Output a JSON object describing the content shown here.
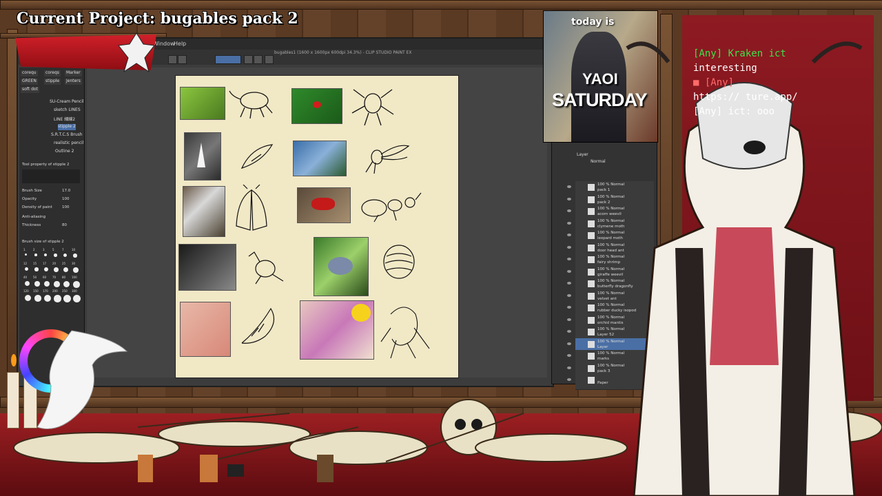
{
  "overlay": {
    "title": "Current Project: bugables pack 2"
  },
  "app": {
    "window_title": "bugables1 (1600 x 1600px 600dpi 34.3%) - CLIP STUDIO PAINT EX",
    "menu": [
      "Window",
      "Help"
    ],
    "tool_tabs": [
      "corequ",
      "coreqs",
      "Marker",
      "GREEN",
      "stipple",
      "Jenters",
      "soft dot"
    ],
    "brushes": [
      "SU-Cream Pencil",
      "sketch LINES",
      "LINE 細線2",
      "stipple 2",
      "S.R.T.C.S Brush",
      "realistic pencil",
      "Outline 2"
    ],
    "tool_property_title": "Tool property of stipple 2",
    "brush_size_label": "Brush Size",
    "brush_size_value": "17.0",
    "opacity_label": "Opacity",
    "opacity_value": "100",
    "density_label": "Density of paint",
    "density_value": "100",
    "antialias_label": "Anti-aliasing",
    "thickness_label": "Thickness",
    "thickness_value": "80",
    "brush_size_panel": "Brush size of stipple 2",
    "size_presets": [
      "1",
      "2",
      "3",
      "5",
      "7",
      "10",
      "12",
      "15",
      "17",
      "20",
      "25",
      "30",
      "40",
      "50",
      "60",
      "70",
      "80",
      "100",
      "120",
      "150",
      "170",
      "200",
      "250",
      "300"
    ],
    "layer_panel": {
      "tab": "Layer",
      "blend": "Normal",
      "layers": [
        {
          "pct": "100 % Normal",
          "name": "pack 1"
        },
        {
          "pct": "100 % Normal",
          "name": "pack 2"
        },
        {
          "pct": "100 % Normal",
          "name": "acorn weevil"
        },
        {
          "pct": "100 % Normal",
          "name": "clymene moth"
        },
        {
          "pct": "100 % Normal",
          "name": "leopard moth"
        },
        {
          "pct": "100 % Normal",
          "name": "door head ant"
        },
        {
          "pct": "100 % Normal",
          "name": "fairy shrimp"
        },
        {
          "pct": "100 % Normal",
          "name": "giraffe weevil"
        },
        {
          "pct": "100 % Normal",
          "name": "butterfly dragonfly"
        },
        {
          "pct": "100 % Normal",
          "name": "velvet ant"
        },
        {
          "pct": "100 % Normal",
          "name": "rubber ducky isopod"
        },
        {
          "pct": "100 % Normal",
          "name": "orchid mantis"
        },
        {
          "pct": "100 % Normal",
          "name": "Layer 52"
        },
        {
          "pct": "100 % Normal",
          "name": "Layer"
        },
        {
          "pct": "100 % Normal",
          "name": "marks"
        },
        {
          "pct": "100 % Normal",
          "name": "pack 3"
        },
        {
          "pct": "",
          "name": "Paper"
        }
      ]
    }
  },
  "meme": {
    "top": "today is",
    "middle": "YAOI",
    "bottom": "SATURDAY"
  },
  "chat": {
    "lines": [
      {
        "text": "[Any] Kraken  ict",
        "color": "#3fe04a"
      },
      {
        "text": "interesting",
        "color": "#ffffff"
      },
      {
        "text": "■ [Any]   ",
        "color": "#ff6a6a"
      },
      {
        "text": "https://   ture.app/",
        "color": "#ffffff"
      },
      {
        "text": "[Any]      ict: ooo",
        "color": "#ffffff"
      }
    ]
  },
  "colors": {
    "accent_red": "#c41a22",
    "canvas_bg": "#f1e8c6",
    "chat_green": "#3fe04a"
  }
}
